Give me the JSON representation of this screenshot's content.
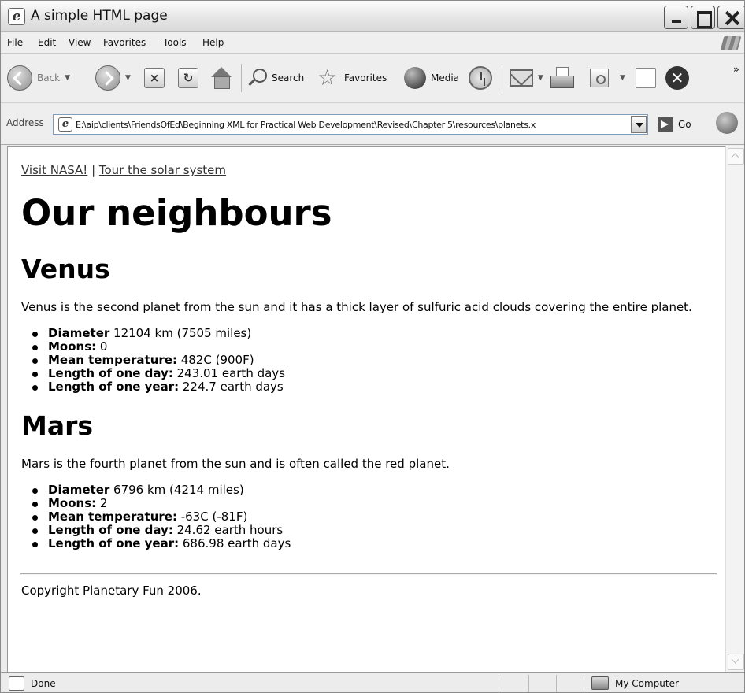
{
  "window": {
    "title": "A simple HTML page"
  },
  "menu": [
    "File",
    "Edit",
    "View",
    "Favorites",
    "Tools",
    "Help"
  ],
  "toolbar": {
    "back_label": "Back",
    "search_label": "Search",
    "favorites_label": "Favorites",
    "media_label": "Media",
    "more_label": "»"
  },
  "address": {
    "label": "Address",
    "url": "E:\\aip\\clients\\FriendsOfEd\\Beginning XML for Practical Web Development\\Revised\\Chapter 5\\resources\\planets.x",
    "go_label": "Go"
  },
  "page": {
    "nav": {
      "link1": "Visit NASA!",
      "separator": " | ",
      "link2": "Tour the solar system"
    },
    "title": "Our neighbours",
    "planets": [
      {
        "name": "Venus",
        "description": "Venus is the second planet from the sun and it has a thick layer of sulfuric acid clouds covering the entire planet.",
        "facts": [
          {
            "label": "Diameter",
            "value": " 12104 km (7505 miles)"
          },
          {
            "label": "Moons:",
            "value": " 0"
          },
          {
            "label": "Mean temperature:",
            "value": " 482C (900F)"
          },
          {
            "label": "Length of one day:",
            "value": " 243.01 earth days"
          },
          {
            "label": "Length of one year:",
            "value": " 224.7 earth days"
          }
        ]
      },
      {
        "name": "Mars",
        "description": "Mars is the fourth planet from the sun and is often called the red planet.",
        "facts": [
          {
            "label": "Diameter",
            "value": " 6796 km (4214 miles)"
          },
          {
            "label": "Moons:",
            "value": " 2"
          },
          {
            "label": "Mean temperature:",
            "value": " -63C (-81F)"
          },
          {
            "label": "Length of one day:",
            "value": " 24.62 earth hours"
          },
          {
            "label": "Length of one year:",
            "value": " 686.98 earth days"
          }
        ]
      }
    ],
    "footer": "Copyright Planetary Fun 2006."
  },
  "status": {
    "text": "Done",
    "zone": "My Computer"
  }
}
